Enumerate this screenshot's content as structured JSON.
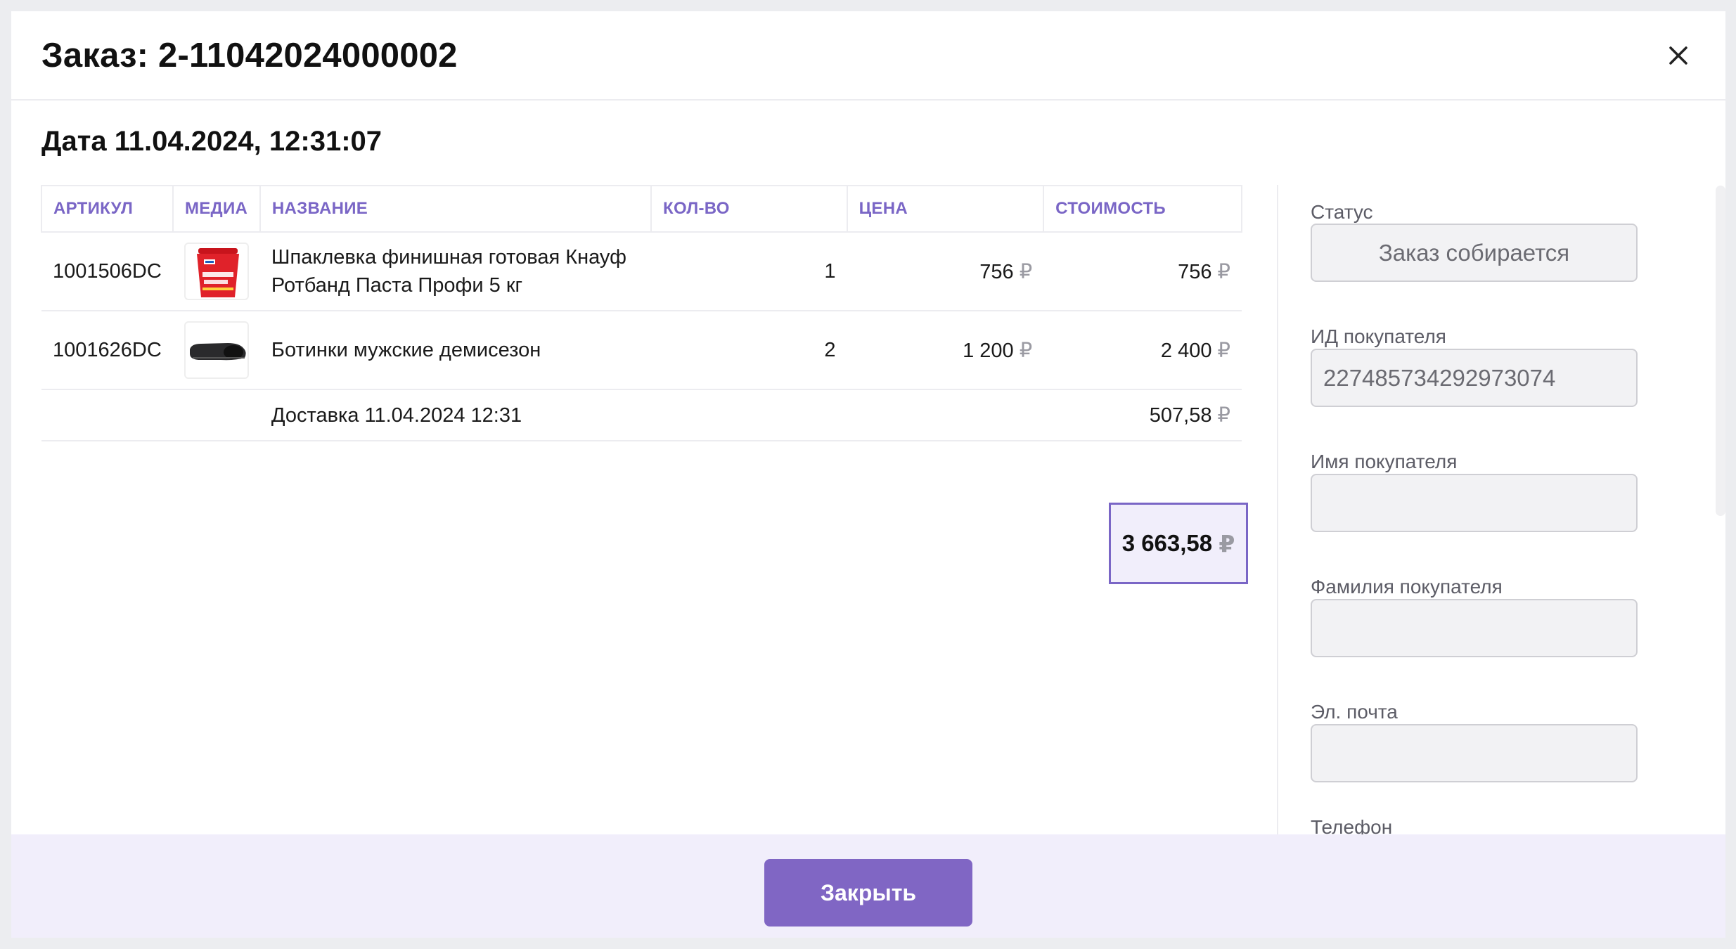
{
  "modal": {
    "title": "Заказ: 2-11042024000002",
    "close_icon": "close-icon"
  },
  "order": {
    "date_title": "Дата 11.04.2024, 12:31:07"
  },
  "table": {
    "headers": {
      "sku": "АРТИКУЛ",
      "media": "МЕДИА",
      "name": "НАЗВАНИЕ",
      "qty": "КОЛ-ВО",
      "price": "ЦЕНА",
      "cost": "СТОИМОСТЬ"
    },
    "rows": [
      {
        "sku": "1001506DC",
        "media_icon": "plaster-bucket-image",
        "name_line1": "Шпаклевка финишная готовая Кнауф",
        "name_line2": "Ротбанд Паста Профи 5 кг",
        "qty": "1",
        "price": "756",
        "cost": "756"
      },
      {
        "sku": "1001626DC",
        "media_icon": "boots-image",
        "name": "Ботинки мужские демисезон",
        "qty": "2",
        "price": "1 200",
        "cost": "2 400"
      }
    ],
    "delivery": {
      "name": "Доставка 11.04.2024 12:31",
      "cost": "507,58"
    },
    "currency": "₽"
  },
  "total": {
    "amount": "3 663,58",
    "currency": "₽"
  },
  "fields": {
    "status": {
      "label": "Статус",
      "value": "Заказ собирается"
    },
    "buyer_id": {
      "label": "ИД покупателя",
      "value": "227485734292973074"
    },
    "first_name": {
      "label": "Имя покупателя",
      "value": ""
    },
    "last_name": {
      "label": "Фамилия покупателя",
      "value": ""
    },
    "email": {
      "label": "Эл. почта",
      "value": ""
    },
    "phone": {
      "label": "Телефон"
    }
  },
  "footer": {
    "close_label": "Закрыть"
  },
  "colors": {
    "accent": "#7a66c6",
    "button": "#8066c4",
    "footer_bg": "#f1eefb"
  }
}
